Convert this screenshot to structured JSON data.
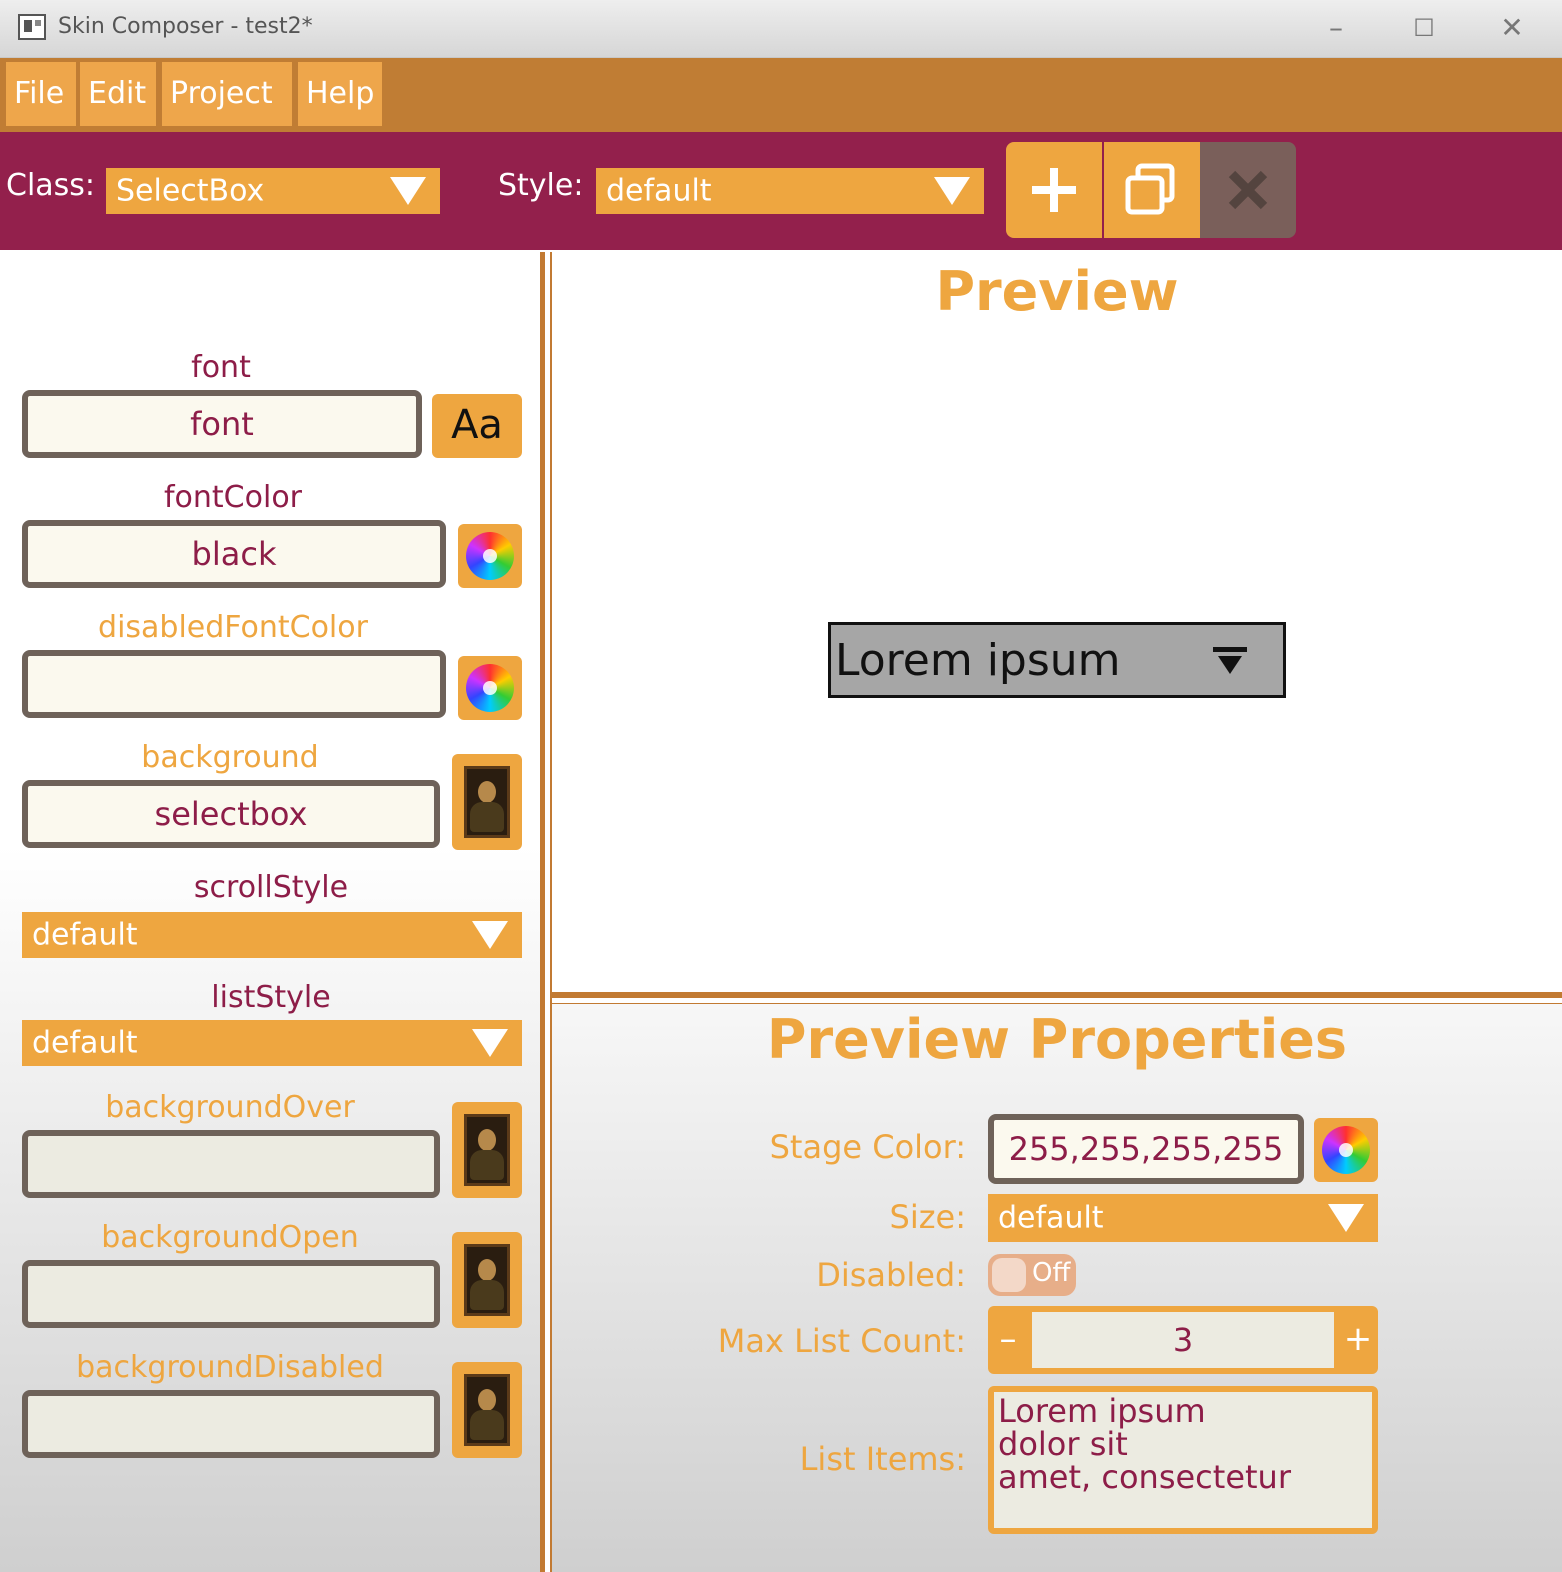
{
  "window": {
    "title": "Skin Composer - test2*",
    "minimize": "–",
    "maximize": "☐",
    "close": "✕"
  },
  "menu": {
    "items": [
      {
        "label": "File"
      },
      {
        "label": "Edit"
      },
      {
        "label": "Project"
      },
      {
        "label": "Help"
      }
    ]
  },
  "toolbar": {
    "class_label": "Class:",
    "class_value": "SelectBox",
    "style_label": "Style:",
    "style_value": "default",
    "new_style_icon": "plus-icon",
    "duplicate_style_icon": "duplicate-icon",
    "delete_style_icon": "close-icon"
  },
  "style_properties": {
    "font": {
      "label": "font",
      "value": "font",
      "button": "Aa"
    },
    "fontColor": {
      "label": "fontColor",
      "value": "black"
    },
    "disabledFontColor": {
      "label": "disabledFontColor",
      "value": ""
    },
    "background": {
      "label": "background",
      "value": "selectbox"
    },
    "scrollStyle": {
      "label": "scrollStyle",
      "value": "default"
    },
    "listStyle": {
      "label": "listStyle",
      "value": "default"
    },
    "backgroundOver": {
      "label": "backgroundOver",
      "value": ""
    },
    "backgroundOpen": {
      "label": "backgroundOpen",
      "value": ""
    },
    "backgroundDisabled": {
      "label": "backgroundDisabled",
      "value": ""
    }
  },
  "preview": {
    "title": "Preview",
    "sample_text": "Lorem ipsum"
  },
  "preview_properties": {
    "title": "Preview Properties",
    "stage_color_label": "Stage Color:",
    "stage_color_value": "255,255,255,255",
    "size_label": "Size:",
    "size_value": "default",
    "disabled_label": "Disabled:",
    "disabled_value": "Off",
    "max_list_count_label": "Max List Count:",
    "max_list_count_value": "3",
    "stepper_minus": "–",
    "stepper_plus": "+",
    "list_items_label": "List Items:",
    "list_items": [
      "Lorem ipsum",
      "dolor sit",
      "amet, consectetur"
    ]
  },
  "colors": {
    "accent_orange": "#eea640",
    "toolbar_maroon": "#93204c",
    "menubar_brown": "#c07d34",
    "text_maroon": "#8d1d48"
  }
}
